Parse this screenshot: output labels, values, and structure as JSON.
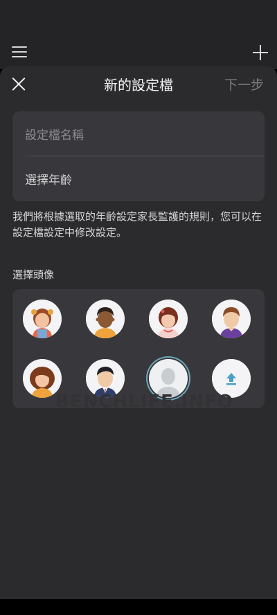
{
  "header": {
    "title": "新的設定檔",
    "next_label": "下一步"
  },
  "form": {
    "name_placeholder": "設定檔名稱",
    "age_label": "選擇年齡"
  },
  "description": "我們將根據選取的年齡設定家長監護的規則，您可以在設定檔設定中修改設定。",
  "avatar_section": {
    "label": "選擇頭像",
    "avatars": [
      {
        "name": "girl-pigtails-avatar",
        "selected": false
      },
      {
        "name": "boy-dark-skin-avatar",
        "selected": false
      },
      {
        "name": "girl-short-hair-avatar",
        "selected": false
      },
      {
        "name": "boy-brown-hair-avatar",
        "selected": false
      },
      {
        "name": "woman-curly-hair-avatar",
        "selected": false
      },
      {
        "name": "man-suit-avatar",
        "selected": false
      },
      {
        "name": "default-silhouette-avatar",
        "selected": true
      },
      {
        "name": "upload-avatar",
        "selected": false
      }
    ]
  },
  "watermark": "BENCHLIFE.INFO",
  "colors": {
    "sheet_bg": "#2b2b2e",
    "card_bg": "#38383c",
    "upload_accent": "#4a9fc8",
    "selected_ring": "#6fa8b8"
  }
}
